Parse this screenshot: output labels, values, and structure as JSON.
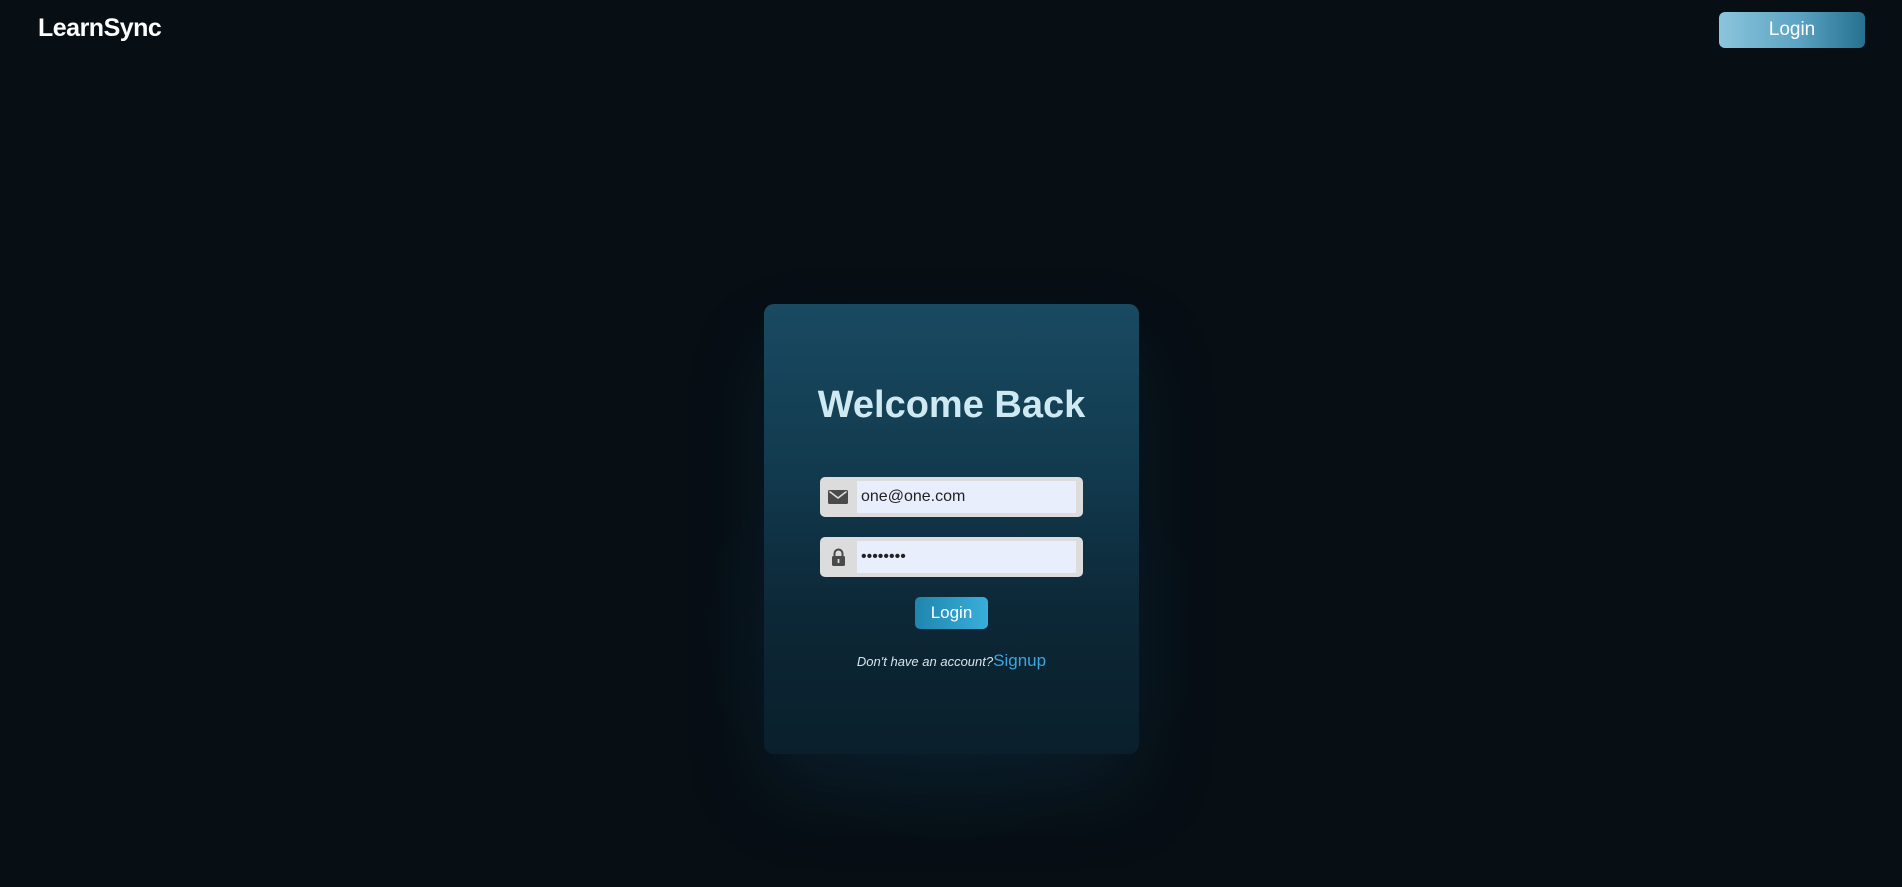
{
  "brand": "LearnSync",
  "nav": {
    "login_label": "Login"
  },
  "card": {
    "title": "Welcome Back",
    "email": {
      "value": "one@one.com",
      "icon": "mail-icon"
    },
    "password": {
      "value": "••••••••",
      "icon": "lock-icon"
    },
    "submit_label": "Login",
    "signup_prompt": "Don't have an account?",
    "signup_link": "Signup"
  },
  "colors": {
    "background": "#070e14",
    "card_top": "#194a61",
    "accent": "#39aedb",
    "title": "#cfe9f3"
  }
}
